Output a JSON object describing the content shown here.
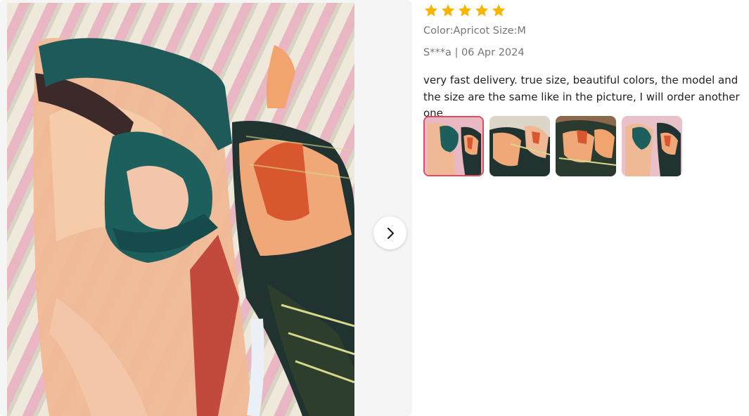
{
  "review": {
    "rating": 5,
    "sku": "Color:Apricot Size:M",
    "meta": "S***a | 06 Apr 2024",
    "text": "very fast delivery. true size, beautiful colors, the model and the size are the same like in the picture, I will order another one",
    "thumbnail_count": 4,
    "selected_thumbnail": 1
  },
  "icons": {
    "star": "star-icon",
    "next": "chevron-right-icon"
  },
  "colors": {
    "star": "#f7b500",
    "thumb_active_border": "#e34a60",
    "meta_text": "#757575",
    "body_text": "#222222"
  }
}
